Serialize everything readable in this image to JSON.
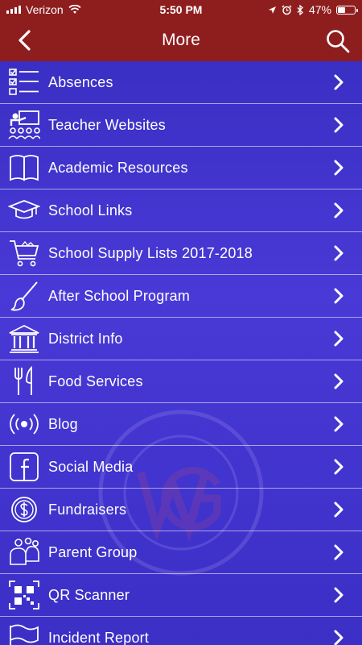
{
  "status_bar": {
    "carrier": "Verizon",
    "time": "5:50 PM",
    "battery_percent": "47%",
    "battery_level": 0.47,
    "icons": [
      "signal-icon",
      "wifi-icon",
      "location-icon",
      "alarm-icon",
      "bluetooth-icon",
      "battery-icon"
    ]
  },
  "nav": {
    "title": "More",
    "back_icon": "chevron-left-icon",
    "search_icon": "search-icon"
  },
  "colors": {
    "header": "#8e1e1e",
    "list_background": "#3b2fc6",
    "text": "#ffffff"
  },
  "menu_items": [
    {
      "label": "Absences",
      "icon": "checklist-icon"
    },
    {
      "label": "Teacher Websites",
      "icon": "teacher-icon"
    },
    {
      "label": "Academic Resources",
      "icon": "book-icon"
    },
    {
      "label": "School Links",
      "icon": "graduation-cap-icon"
    },
    {
      "label": "School Supply Lists 2017-2018",
      "icon": "shopping-cart-icon"
    },
    {
      "label": "After School Program",
      "icon": "paintbrush-icon"
    },
    {
      "label": "District Info",
      "icon": "building-icon"
    },
    {
      "label": "Food Services",
      "icon": "utensils-icon"
    },
    {
      "label": "Blog",
      "icon": "broadcast-icon"
    },
    {
      "label": "Social Media",
      "icon": "facebook-icon"
    },
    {
      "label": "Fundraisers",
      "icon": "dollar-coin-icon"
    },
    {
      "label": "Parent Group",
      "icon": "people-icon"
    },
    {
      "label": "QR Scanner",
      "icon": "qr-code-icon"
    },
    {
      "label": "Incident Report",
      "icon": "flag-icon"
    }
  ]
}
